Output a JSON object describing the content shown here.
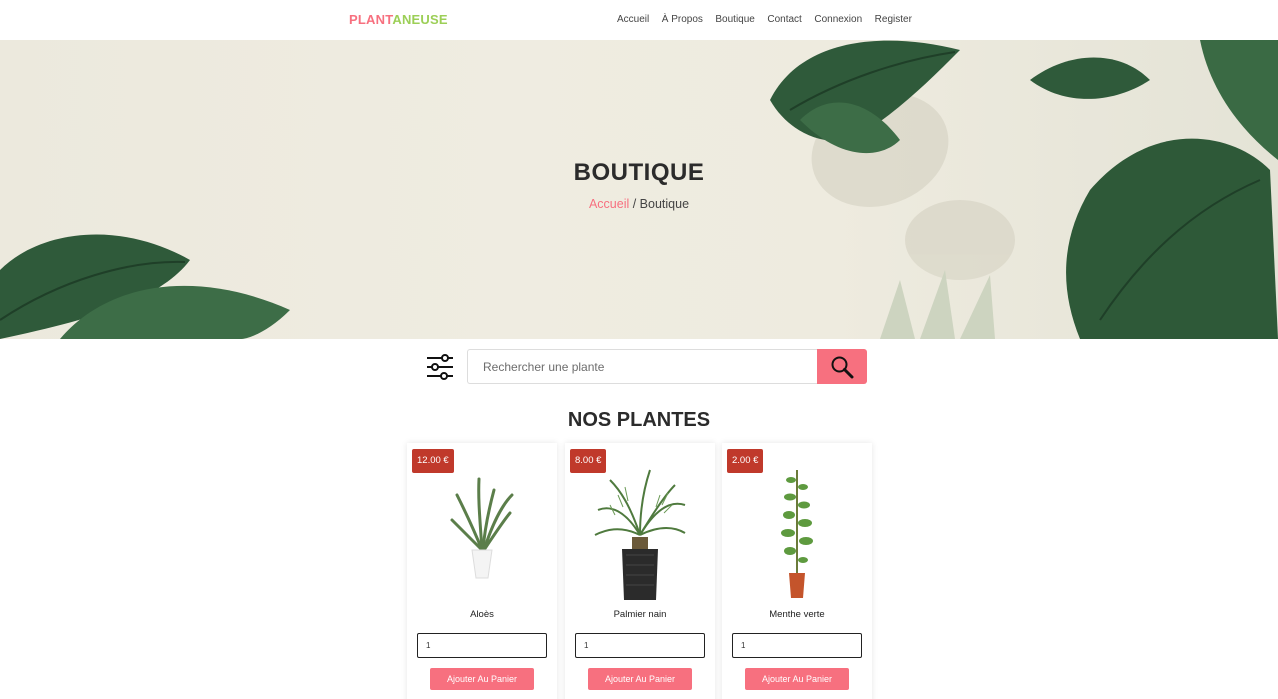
{
  "brand": {
    "part1": "PLANT",
    "part2": "ANEUSE"
  },
  "nav": [
    "Accueil",
    "À Propos",
    "Boutique",
    "Contact",
    "Connexion",
    "Register"
  ],
  "hero": {
    "title": "BOUTIQUE",
    "crumb_link": "Accueil",
    "crumb_sep": " / ",
    "crumb_current": "Boutique"
  },
  "search": {
    "placeholder": "Rechercher une plante"
  },
  "section_title": "NOS PLANTES",
  "products": [
    {
      "price": "12.00 €",
      "name": "Aloès",
      "qty": "1",
      "button": "Ajouter Au Panier",
      "icon": "aloe-plant-image"
    },
    {
      "price": "8.00 €",
      "name": "Palmier nain",
      "qty": "1",
      "button": "Ajouter Au Panier",
      "icon": "palm-plant-image"
    },
    {
      "price": "2.00 €",
      "name": "Menthe verte",
      "qty": "1",
      "button": "Ajouter Au Panier",
      "icon": "mint-plant-image"
    }
  ],
  "colors": {
    "accent": "#f7707f",
    "brand_green": "#9ccf57",
    "price_badge": "#c0392b"
  }
}
